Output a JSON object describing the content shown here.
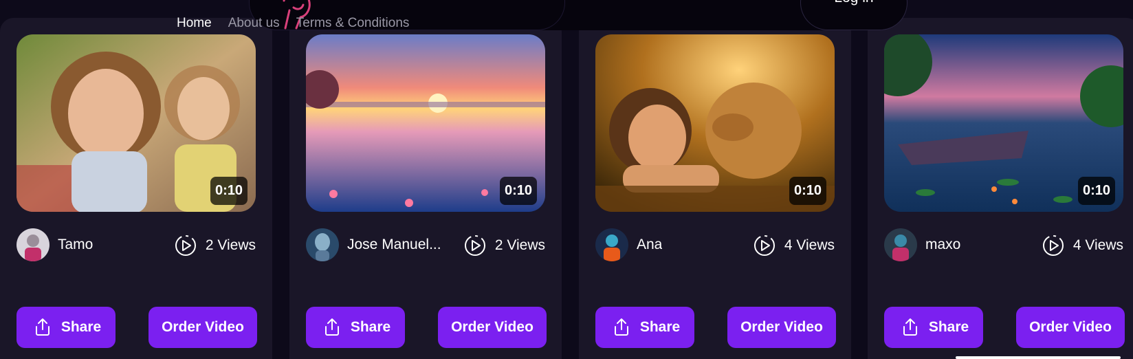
{
  "nav": {
    "links": [
      "Home",
      "About us",
      "Terms & Conditions"
    ],
    "login_label": "Log in"
  },
  "cards": [
    {
      "author": "Tamo",
      "views": "2 Views",
      "duration": "0:10",
      "share_label": "Share",
      "order_label": "Order Video"
    },
    {
      "author": "Jose Manuel...",
      "views": "2 Views",
      "duration": "0:10",
      "share_label": "Share",
      "order_label": "Order Video"
    },
    {
      "author": "Ana",
      "views": "4 Views",
      "duration": "0:10",
      "share_label": "Share",
      "order_label": "Order Video"
    },
    {
      "author": "maxo",
      "views": "4 Views",
      "duration": "0:10",
      "share_label": "Share",
      "order_label": "Order Video"
    }
  ],
  "colors": {
    "background": "#0d0a1a",
    "card": "#1a1628",
    "accent": "#7b20f0"
  }
}
